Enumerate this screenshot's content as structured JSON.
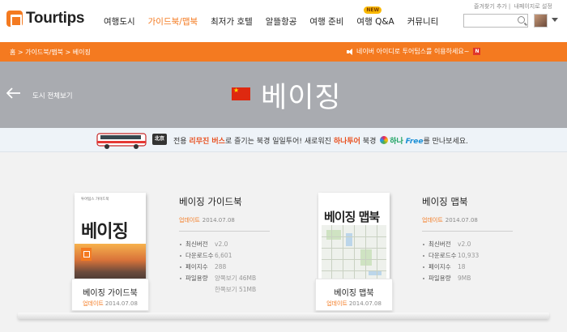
{
  "header": {
    "logo_text": "Tourtips",
    "nav": [
      {
        "label": "여행도시",
        "active": false
      },
      {
        "label": "가이드북/맵북",
        "active": true
      },
      {
        "label": "최저가 호텔",
        "active": false
      },
      {
        "label": "알뜰항공",
        "active": false
      },
      {
        "label": "여행 준비",
        "active": false
      },
      {
        "label": "여행 Q&A",
        "active": false,
        "badge": "NEW"
      },
      {
        "label": "커뮤니티",
        "active": false
      }
    ],
    "util_links": [
      "즐겨찾기 추가",
      "내페이지로 설정"
    ],
    "search_placeholder": ""
  },
  "orange_bar": {
    "breadcrumb": "홈 > 가이드북/맵북 > 베이징",
    "notice": "네이버 아이디로 투어팁스를 이용하세요~",
    "notice_badge": "N",
    "colors": {
      "accent": "#f47a20"
    }
  },
  "city": {
    "back_label": "도시 전체보기",
    "name": "베이징",
    "flag": "china-flag"
  },
  "ad": {
    "sticker": "北京",
    "parts": {
      "p1": "전용 ",
      "p2": "리무진 버스",
      "p3": "로 즐기는 북경 일일투어! 새로워진 ",
      "p4": "하나투어",
      "p5": " 북경 ",
      "p6": "하나",
      "p7": "Free",
      "p8": "를 만나보세요."
    }
  },
  "books": {
    "guide": {
      "cover_publisher": "투어팁스 가이드북",
      "cover_title": "베이징",
      "stand_title": "베이징 가이드북",
      "stand_update_label": "업데이트",
      "stand_date": "2014.07.08",
      "info_title": "베이징 가이드북",
      "info_update_label": "업데이트",
      "info_date": "2014.07.08",
      "rows": [
        {
          "k": "최신버전",
          "v": "v2.0"
        },
        {
          "k": "다운로드수",
          "v": "6,601"
        },
        {
          "k": "페이지수",
          "v": "288"
        },
        {
          "k": "파일용량",
          "v": "양쪽보기 46MB"
        }
      ],
      "extra_size": "한쪽보기 51MB"
    },
    "map": {
      "cover_title": "베이징 맵북",
      "stand_title": "베이징 맵북",
      "stand_update_label": "업데이트",
      "stand_date": "2014.07.08",
      "info_title": "베이징 맵북",
      "info_update_label": "업데이트",
      "info_date": "2014.07.08",
      "rows": [
        {
          "k": "최신버전",
          "v": "v2.0"
        },
        {
          "k": "다운로드수",
          "v": "10,933"
        },
        {
          "k": "페이지수",
          "v": "18"
        },
        {
          "k": "파일용량",
          "v": "9MB"
        }
      ]
    }
  }
}
